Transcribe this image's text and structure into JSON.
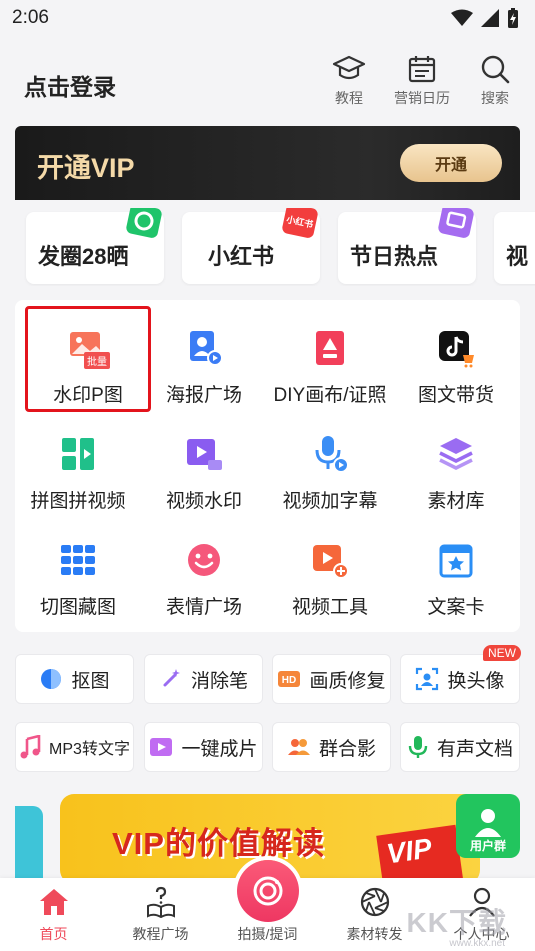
{
  "status": {
    "time": "2:06"
  },
  "header": {
    "title": "点击登录",
    "buttons": [
      {
        "label": "教程",
        "icon": "graduation-cap-icon"
      },
      {
        "label": "营销日历",
        "icon": "calendar-icon"
      },
      {
        "label": "搜索",
        "icon": "search-icon"
      }
    ]
  },
  "vip": {
    "title": "开通VIP",
    "button": "开通"
  },
  "chips": [
    {
      "label": "发圈28晒",
      "badge_color": "#1fc46a"
    },
    {
      "label": "小红书",
      "badge_color": "#f23d3d",
      "badge_text": "小红书"
    },
    {
      "label": "节日热点",
      "badge_color": "#a56cf0"
    },
    {
      "label": "视"
    }
  ],
  "tools": [
    {
      "label": "水印P图",
      "icon": "watermark-photo-icon",
      "badge": "批量",
      "selected": true
    },
    {
      "label": "海报广场",
      "icon": "poster-icon"
    },
    {
      "label": "DIY画布/证照",
      "icon": "canvas-icon"
    },
    {
      "label": "图文带货",
      "icon": "tiktok-cart-icon"
    },
    {
      "label": "拼图拼视频",
      "icon": "collage-icon"
    },
    {
      "label": "视频水印",
      "icon": "video-watermark-icon"
    },
    {
      "label": "视频加字幕",
      "icon": "microphone-icon"
    },
    {
      "label": "素材库",
      "icon": "layers-icon"
    },
    {
      "label": "切图藏图",
      "icon": "grid-icon"
    },
    {
      "label": "表情广场",
      "icon": "smile-icon"
    },
    {
      "label": "视频工具",
      "icon": "video-tool-icon"
    },
    {
      "label": "文案卡",
      "icon": "star-card-icon"
    }
  ],
  "quick_tools": [
    {
      "label": "抠图",
      "icon": "cutout-icon"
    },
    {
      "label": "消除笔",
      "icon": "magic-wand-icon"
    },
    {
      "label": "画质修复",
      "icon": "hd-icon"
    },
    {
      "label": "换头像",
      "icon": "face-swap-icon",
      "badge": "NEW"
    },
    {
      "label": "MP3转文字",
      "icon": "music-note-icon"
    },
    {
      "label": "一键成片",
      "icon": "play-icon"
    },
    {
      "label": "群合影",
      "icon": "group-photo-icon"
    },
    {
      "label": "有声文档",
      "icon": "voice-doc-icon"
    }
  ],
  "promo": {
    "text": "VIP的价值解读",
    "tag": "VIP",
    "user_group": "用户群"
  },
  "tabs": [
    {
      "label": "首页",
      "active": true
    },
    {
      "label": "教程广场"
    },
    {
      "label": "拍摄/提词"
    },
    {
      "label": "素材转发"
    },
    {
      "label": "个人中心"
    }
  ],
  "watermark": {
    "text": "KK下载",
    "sub": "www.kkx.net"
  }
}
